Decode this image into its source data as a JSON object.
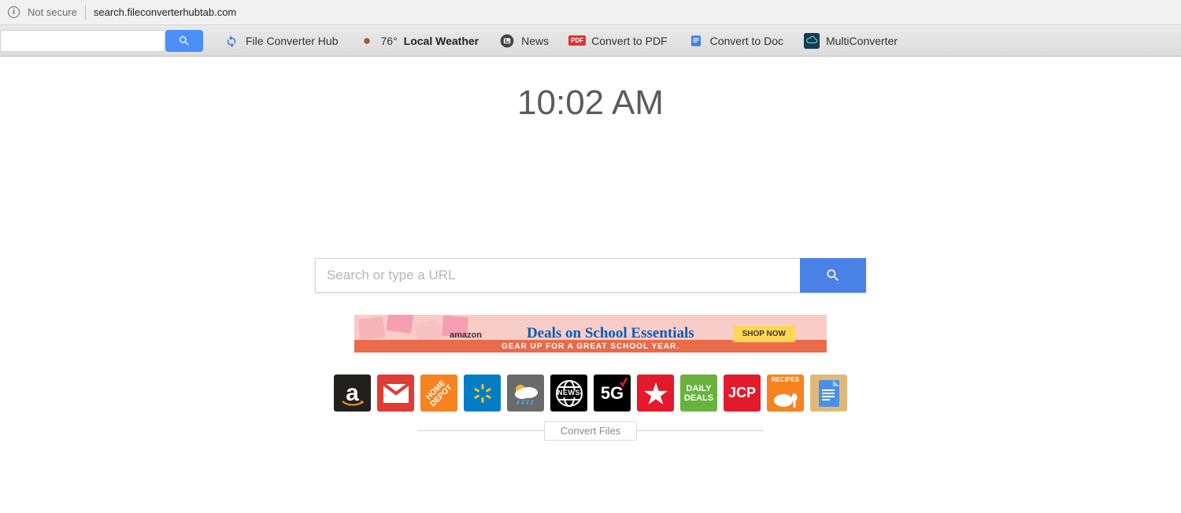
{
  "url_bar": {
    "security_label": "Not secure",
    "url_host": "search.fileconverterhubtab.com"
  },
  "toolbar": {
    "search_value": "",
    "links": {
      "hub": {
        "label": "File Converter Hub"
      },
      "weather": {
        "temp": "76°",
        "label": "Local Weather"
      },
      "news": {
        "label": "News"
      },
      "pdf": {
        "label": "Convert to PDF",
        "badge": "PDF"
      },
      "doc": {
        "label": "Convert to Doc"
      },
      "multi": {
        "label": "MultiConverter"
      }
    }
  },
  "clock": {
    "time": "10:02 AM"
  },
  "main_search": {
    "placeholder": "Search or type a URL"
  },
  "ad": {
    "brand": "amazon",
    "title": "Deals on School Essentials",
    "subtitle": "GEAR UP FOR A GREAT SCHOOL YEAR.",
    "cta": "SHOP NOW"
  },
  "tiles": {
    "amazon": {
      "bg": "#221f1f",
      "text": "a",
      "sub_color": "#f59b00"
    },
    "gmail": {
      "bg": "#e03b36"
    },
    "homedepot": {
      "bg": "#f6831f",
      "text": "HOME DEPOT"
    },
    "walmart": {
      "bg": "#007dc6"
    },
    "weather": {
      "bg": "#6a6a6a"
    },
    "news": {
      "bg": "#000000",
      "text": "NEWS"
    },
    "fiveg": {
      "bg": "#000000",
      "text": "5G"
    },
    "macys": {
      "bg": "#e21a2c"
    },
    "dailydeals": {
      "bg": "#68b23d",
      "text": "DAILY DEALS"
    },
    "jcp": {
      "bg": "#e21a2c",
      "text": "JCP"
    },
    "recipes": {
      "bg": "#f6831f",
      "text": "RECIPES"
    },
    "docs": {
      "bg": "#e0b97a"
    }
  },
  "section": {
    "convert_files_label": "Convert Files"
  }
}
